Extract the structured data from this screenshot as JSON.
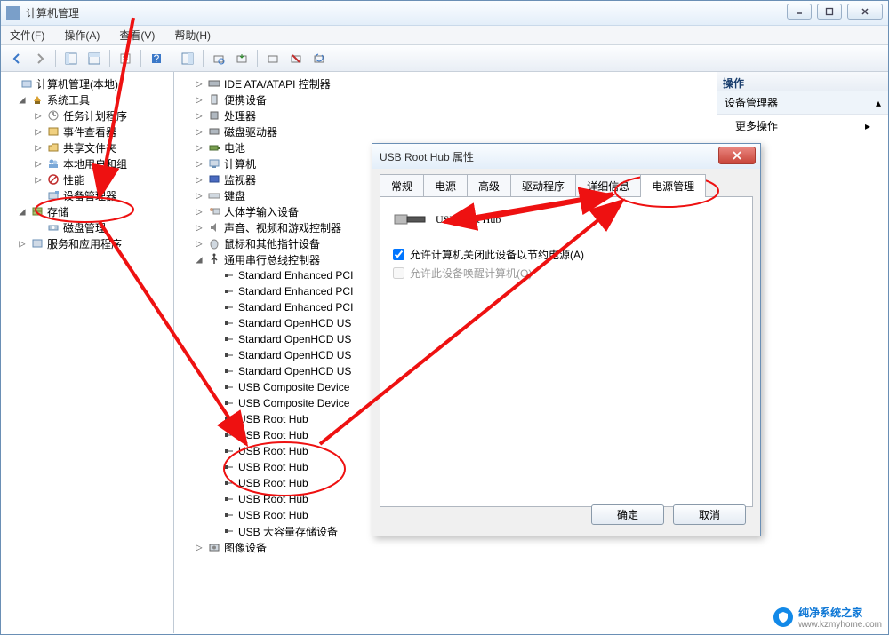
{
  "window": {
    "title": "计算机管理",
    "controls": {
      "min": "—",
      "max": "□",
      "close": "X"
    }
  },
  "menu": {
    "file": "文件(F)",
    "action": "操作(A)",
    "view": "查看(V)",
    "help": "帮助(H)"
  },
  "tree": {
    "root": "计算机管理(本地)",
    "sys_tools": "系统工具",
    "task_scheduler": "任务计划程序",
    "event_viewer": "事件查看器",
    "shared_folders": "共享文件夹",
    "local_users": "本地用户和组",
    "performance": "性能",
    "device_manager": "设备管理器",
    "storage": "存储",
    "disk_mgmt": "磁盘管理",
    "services": "服务和应用程序"
  },
  "devices": {
    "ide": "IDE ATA/ATAPI 控制器",
    "portable": "便携设备",
    "cpu": "处理器",
    "disk_drives": "磁盘驱动器",
    "battery": "电池",
    "computer": "计算机",
    "monitor": "监视器",
    "keyboard": "键盘",
    "hid": "人体学输入设备",
    "sound": "声音、视频和游戏控制器",
    "mouse": "鼠标和其他指针设备",
    "usb_ctrl": "通用串行总线控制器",
    "enh_pci": "Standard Enhanced PCI",
    "openhcd": "Standard OpenHCD US",
    "composite": "USB Composite Device",
    "root_hub": "USB Root Hub",
    "mass_storage": "USB 大容量存储设备",
    "imaging": "图像设备"
  },
  "actions": {
    "header": "操作",
    "device_manager": "设备管理器",
    "more": "更多操作"
  },
  "dialog": {
    "title": "USB Root Hub 属性",
    "tabs": {
      "general": "常规",
      "power": "电源",
      "advanced": "高级",
      "driver": "驱动程序",
      "details": "详细信息",
      "powermgmt": "电源管理"
    },
    "device_name": "USB Root Hub",
    "checkbox1": "允许计算机关闭此设备以节约电源(A)",
    "checkbox2": "允许此设备唤醒计算机(O)",
    "ok": "确定",
    "cancel": "取消"
  },
  "watermark": {
    "main": "纯净系统之家",
    "sub": "www.kzmyhome.com"
  }
}
